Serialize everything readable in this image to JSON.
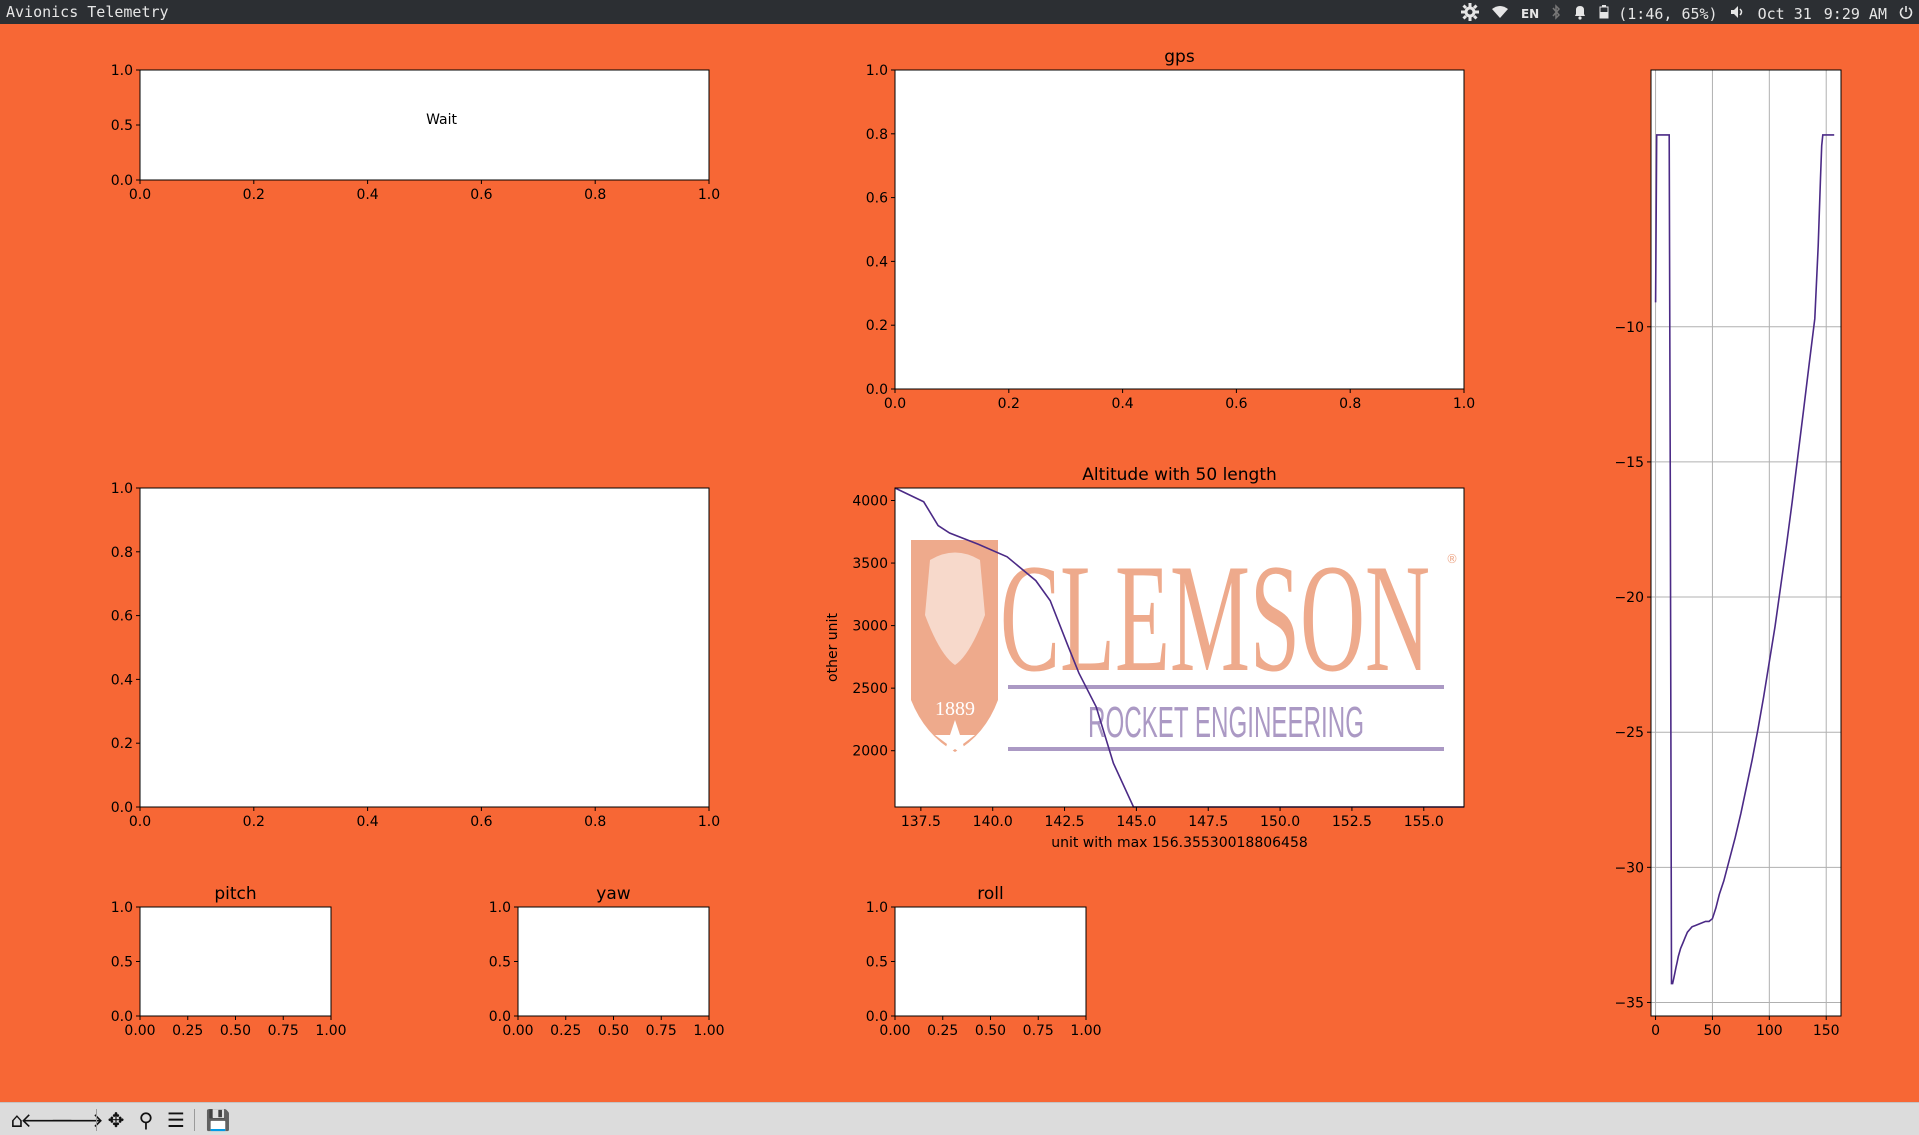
{
  "window": {
    "title": "Avionics Telemetry"
  },
  "systembar": {
    "keyboard_layout": "EN",
    "battery": "(1:46, 65%)",
    "date": "Oct 31",
    "time": "9:29 AM",
    "icons": [
      "gear-icon",
      "wifi-icon",
      "keyboard-icon",
      "bluetooth-icon",
      "bell-icon",
      "battery-icon",
      "volume-icon",
      "power-icon"
    ]
  },
  "colors": {
    "background": "#f76735",
    "line": "#4b2a86",
    "logo_orange": "#eeaa8c",
    "logo_purple": "#ab99c4"
  },
  "logo": {
    "name": "CLEMSON",
    "subtitle": "ROCKET ENGINEERING",
    "year": "1889"
  },
  "toolbar": {
    "buttons": [
      {
        "icon": "home-icon",
        "glyph": "⌂"
      },
      {
        "icon": "back-arrow-icon",
        "glyph": "🡐"
      },
      {
        "icon": "forward-arrow-icon",
        "glyph": "🡒"
      },
      {
        "icon": "pan-icon",
        "glyph": "✥"
      },
      {
        "icon": "zoom-icon",
        "glyph": "⚲"
      },
      {
        "icon": "configure-subplots-icon",
        "glyph": "☰"
      },
      {
        "icon": "save-icon",
        "glyph": "💾"
      }
    ]
  },
  "chart_data": [
    {
      "id": "status",
      "type": "line",
      "title": "",
      "annotation": "Wait",
      "xlim": [
        0,
        1
      ],
      "ylim": [
        0,
        1
      ],
      "xticks": [
        "0.0",
        "0.2",
        "0.4",
        "0.6",
        "0.8",
        "1.0"
      ],
      "yticks": [
        "0.0",
        "0.5",
        "1.0"
      ],
      "series": []
    },
    {
      "id": "gps",
      "type": "line",
      "title": "gps",
      "xlim": [
        0,
        1
      ],
      "ylim": [
        0,
        1
      ],
      "xticks": [
        "0.0",
        "0.2",
        "0.4",
        "0.6",
        "0.8",
        "1.0"
      ],
      "yticks": [
        "0.0",
        "0.2",
        "0.4",
        "0.6",
        "0.8",
        "1.0"
      ],
      "series": []
    },
    {
      "id": "side",
      "type": "line",
      "title": "",
      "grid": true,
      "xlim": [
        -4,
        163
      ],
      "ylim": [
        -35.5,
        -0.5
      ],
      "xticks": [
        "0",
        "50",
        "100",
        "150"
      ],
      "yticks": [
        "−35",
        "−30",
        "−25",
        "−20",
        "−15",
        "−10"
      ],
      "series": [
        {
          "x": [
            0,
            1,
            2,
            3,
            4,
            5,
            6,
            7,
            8,
            9,
            10,
            11,
            12,
            13,
            14,
            15,
            16,
            17,
            18,
            19,
            20,
            22,
            24,
            26,
            28,
            30,
            32,
            35,
            38,
            41,
            44,
            47,
            50,
            53,
            56,
            60,
            65,
            70,
            75,
            80,
            85,
            90,
            95,
            100,
            105,
            110,
            115,
            120,
            125,
            130,
            135,
            140,
            143,
            145,
            146,
            147,
            148,
            150,
            152,
            155,
            157
          ],
          "y": [
            -9.1,
            -2.9,
            -2.9,
            -2.9,
            -2.9,
            -2.9,
            -2.9,
            -2.9,
            -2.9,
            -2.9,
            -2.9,
            -2.9,
            -2.9,
            -16,
            -34.3,
            -34.3,
            -34.1,
            -33.9,
            -33.7,
            -33.5,
            -33.3,
            -33.0,
            -32.8,
            -32.6,
            -32.4,
            -32.3,
            -32.2,
            -32.15,
            -32.1,
            -32.05,
            -32.0,
            -32.0,
            -31.9,
            -31.5,
            -31.0,
            -30.5,
            -29.7,
            -28.9,
            -28.0,
            -27.0,
            -26.0,
            -24.9,
            -23.7,
            -22.4,
            -21.1,
            -19.6,
            -18.1,
            -16.5,
            -14.8,
            -13.1,
            -11.4,
            -9.7,
            -7.0,
            -4.5,
            -3.3,
            -2.9,
            -2.9,
            -2.9,
            -2.9,
            -2.9,
            -2.9
          ]
        }
      ]
    },
    {
      "id": "mid-left",
      "type": "line",
      "title": "",
      "xlim": [
        0,
        1
      ],
      "ylim": [
        0,
        1
      ],
      "xticks": [
        "0.0",
        "0.2",
        "0.4",
        "0.6",
        "0.8",
        "1.0"
      ],
      "yticks": [
        "0.0",
        "0.2",
        "0.4",
        "0.6",
        "0.8",
        "1.0"
      ],
      "series": []
    },
    {
      "id": "altitude",
      "type": "line",
      "title": "Altitude with 50 length",
      "xlabel": "unit with max 156.35530018806458",
      "ylabel": "other unit",
      "xlim": [
        136.6,
        156.4
      ],
      "ylim": [
        1550,
        4100
      ],
      "xticks": [
        "137.5",
        "140.0",
        "142.5",
        "145.0",
        "147.5",
        "150.0",
        "152.5",
        "155.0"
      ],
      "yticks": [
        "2000",
        "2500",
        "3000",
        "3500",
        "4000"
      ],
      "series": [
        {
          "x": [
            136.6,
            137.6,
            138.1,
            138.5,
            139.5,
            140.5,
            141.5,
            142.0,
            142.6,
            143.0,
            143.6,
            144.2,
            144.9,
            145.5,
            146.2,
            156.4
          ],
          "y": [
            4100,
            3990,
            3800,
            3740,
            3650,
            3550,
            3360,
            3200,
            2850,
            2620,
            2350,
            1900,
            1550,
            1550,
            1550,
            1550
          ]
        }
      ]
    },
    {
      "id": "pitch",
      "type": "line",
      "title": "pitch",
      "xlim": [
        0,
        1
      ],
      "ylim": [
        0,
        1
      ],
      "xticks": [
        "0.00",
        "0.25",
        "0.50",
        "0.75",
        "1.00"
      ],
      "yticks": [
        "0.0",
        "0.5",
        "1.0"
      ],
      "series": []
    },
    {
      "id": "yaw",
      "type": "line",
      "title": "yaw",
      "xlim": [
        0,
        1
      ],
      "ylim": [
        0,
        1
      ],
      "xticks": [
        "0.00",
        "0.25",
        "0.50",
        "0.75",
        "1.00"
      ],
      "yticks": [
        "0.0",
        "0.5",
        "1.0"
      ],
      "series": []
    },
    {
      "id": "roll",
      "type": "line",
      "title": "roll",
      "xlim": [
        0,
        1
      ],
      "ylim": [
        0,
        1
      ],
      "xticks": [
        "0.00",
        "0.25",
        "0.50",
        "0.75",
        "1.00"
      ],
      "yticks": [
        "0.0",
        "0.5",
        "1.0"
      ],
      "series": []
    }
  ]
}
